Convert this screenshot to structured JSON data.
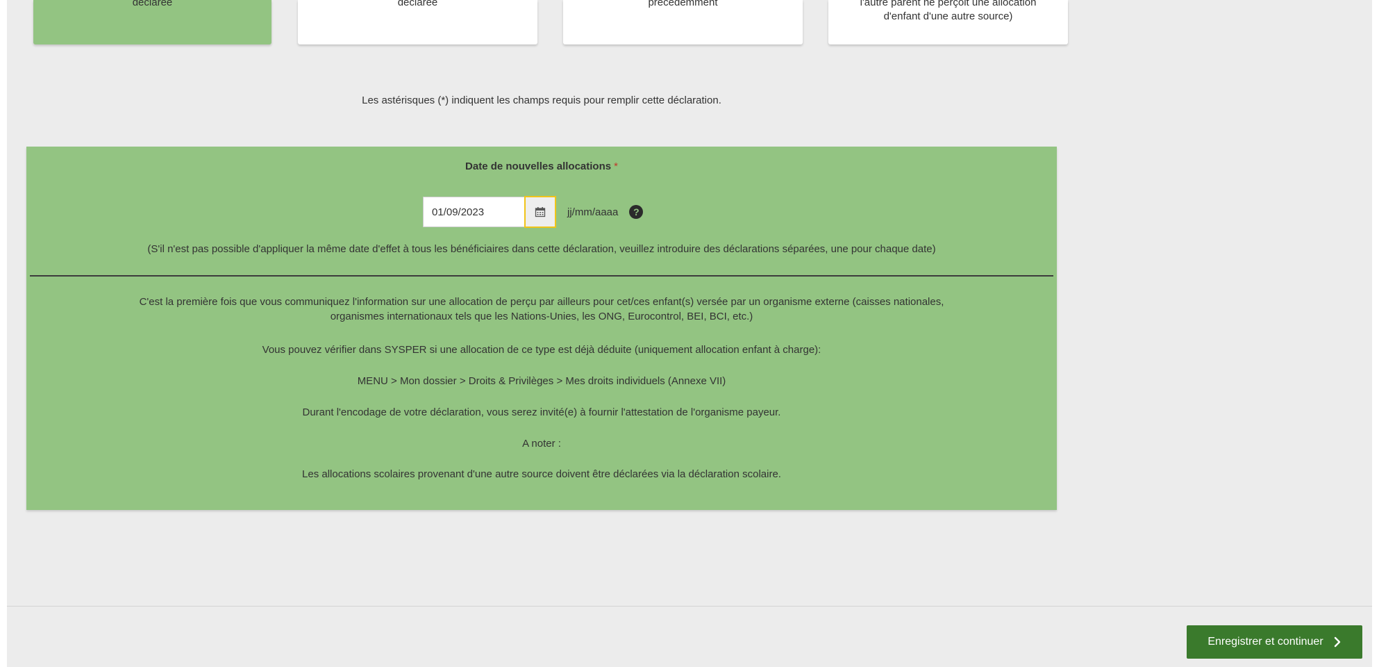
{
  "cards": [
    {
      "lines": [
        "déclarée"
      ],
      "selected": true
    },
    {
      "lines": [
        "déclarée"
      ],
      "selected": false
    },
    {
      "lines": [
        "précédemment"
      ],
      "selected": false
    },
    {
      "lines": [
        "l'autre parent ne perçoit une allocation",
        "d'enfant d'une autre source)"
      ],
      "selected": false
    }
  ],
  "required_note": "Les astérisques (*) indiquent les champs requis pour remplir cette déclaration.",
  "form": {
    "date_label": "Date de nouvelles allocations",
    "required_marker": "*",
    "date_value": "01/09/2023",
    "date_format": "jj/mm/aaaa",
    "help_symbol": "?",
    "date_hint": "(S'il n'est pas possible d'appliquer la même date d'effet à tous les bénéficiaires dans cette déclaration, veuillez introduire des déclarations séparées, une pour chaque date)"
  },
  "info": {
    "first_line_1": "C'est la première fois que vous communiquez l'information sur une allocation de perçu par ailleurs pour cet/ces enfant(s) versée par un organisme externe (caisses nationales,",
    "first_line_2": "organismes internationaux tels que les Nations-Unies, les ONG, Eurocontrol, BEI, BCI, etc.)",
    "sysper_check": "Vous pouvez vérifier dans SYSPER si une allocation de ce type est déjà déduite (uniquement allocation enfant à charge):",
    "menu_path": "MENU > Mon dossier > Droits & Privilèges > Mes droits individuels (Annexe VII)",
    "attestation": "Durant l'encodage de votre déclaration, vous serez invité(e) à fournir l'attestation de l'organisme payeur.",
    "note_label": "A noter :",
    "school_note": "Les allocations scolaires provenant d'une autre source doivent être déclarées via la déclaration scolaire."
  },
  "footer": {
    "continue_label": "Enregistrer et continuer",
    "continue_icon": "chevron-right-icon"
  },
  "colors": {
    "panel_green": "#93c482",
    "button_green": "#3a7a2c",
    "focus_yellow": "#f0c419",
    "background": "#ececec"
  }
}
